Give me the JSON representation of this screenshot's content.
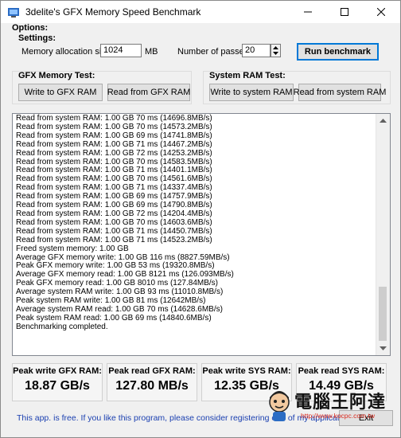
{
  "window": {
    "title": "3delite's GFX Memory Speed Benchmark"
  },
  "icons": {
    "app": "app-icon",
    "minimize": "minimize-icon",
    "maximize": "maximize-icon",
    "close": "close-icon",
    "spin_up": "spin-up-icon",
    "spin_down": "spin-down-icon",
    "scroll_up": "scroll-up-icon",
    "scroll_down": "scroll-down-icon"
  },
  "options": {
    "header": "Options:",
    "settings_label": "Settings:",
    "alloc_label": "Memory allocation size:",
    "alloc_value": "1024",
    "alloc_unit": "MB",
    "passes_label": "Number of passes:",
    "passes_value": "20",
    "run_button": "Run benchmark"
  },
  "gfx_test": {
    "label": "GFX Memory Test:",
    "write_button": "Write to GFX RAM",
    "read_button": "Read from GFX RAM"
  },
  "sys_test": {
    "label": "System RAM Test:",
    "write_button": "Write to system RAM",
    "read_button": "Read from system RAM"
  },
  "log": [
    "Read from system RAM: 1.00 GB 70 ms (14696.8MB/s)",
    "Read from system RAM: 1.00 GB 70 ms (14573.2MB/s)",
    "Read from system RAM: 1.00 GB 69 ms (14741.8MB/s)",
    "Read from system RAM: 1.00 GB 71 ms (14467.2MB/s)",
    "Read from system RAM: 1.00 GB 72 ms (14253.2MB/s)",
    "Read from system RAM: 1.00 GB 70 ms (14583.5MB/s)",
    "Read from system RAM: 1.00 GB 71 ms (14401.1MB/s)",
    "Read from system RAM: 1.00 GB 70 ms (14561.6MB/s)",
    "Read from system RAM: 1.00 GB 71 ms (14337.4MB/s)",
    "Read from system RAM: 1.00 GB 69 ms (14757.9MB/s)",
    "Read from system RAM: 1.00 GB 69 ms (14790.8MB/s)",
    "Read from system RAM: 1.00 GB 72 ms (14204.4MB/s)",
    "Read from system RAM: 1.00 GB 70 ms (14603.6MB/s)",
    "Read from system RAM: 1.00 GB 71 ms (14450.7MB/s)",
    "Read from system RAM: 1.00 GB 71 ms (14523.2MB/s)",
    "Freed system memory: 1.00 GB",
    "Average GFX memory write: 1.00 GB 116 ms (8827.59MB/s)",
    "Peak GFX memory write: 1.00 GB 53 ms (19320.8MB/s)",
    "Average GFX memory read: 1.00 GB 8121 ms (126.093MB/s)",
    "Peak GFX memory read: 1.00 GB 8010 ms (127.84MB/s)",
    "Average system RAM write: 1.00 GB 93 ms (11010.8MB/s)",
    "Peak system RAM write: 1.00 GB 81 ms (12642MB/s)",
    "Average system RAM read: 1.00 GB 70 ms (14628.6MB/s)",
    "Peak system RAM read: 1.00 GB 69 ms (14840.6MB/s)",
    "Benchmarking completed."
  ],
  "stats": [
    {
      "label": "Peak write GFX RAM:",
      "value": "18.87 GB/s"
    },
    {
      "label": "Peak read GFX RAM:",
      "value": "127.80 MB/s"
    },
    {
      "label": "Peak write SYS RAM:",
      "value": "12.35 GB/s"
    },
    {
      "label": "Peak read SYS RAM:",
      "value": "14.49 GB/s"
    }
  ],
  "footer": {
    "info": "This app. is free. If you like this program, please consider registering one of my applications.",
    "exit_button": "Exit"
  },
  "watermark": {
    "name": "電腦王阿達",
    "url": "http://www.kocpc.com.tw"
  },
  "colors": {
    "accent": "#0078d7",
    "link": "#1a3fb0",
    "watermark": "#d9281c"
  }
}
